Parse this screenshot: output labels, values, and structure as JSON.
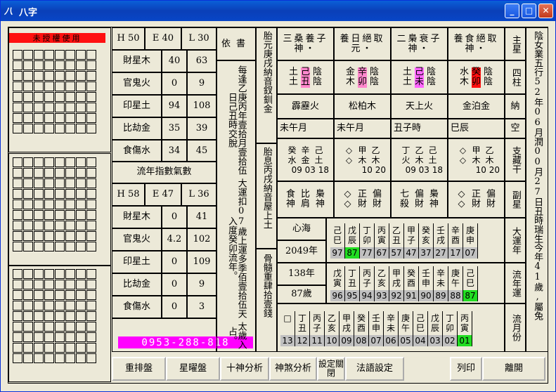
{
  "window": {
    "title": "八字",
    "icon": "八"
  },
  "left": {
    "notice": "未授權使用",
    "grid_cells": 49
  },
  "index1": {
    "H": "H 50",
    "E": "E 40",
    "L": "L 30",
    "rows": [
      {
        "label": "財星木",
        "a": "40",
        "b": "63"
      },
      {
        "label": "官鬼火",
        "a": "0",
        "b": "9"
      },
      {
        "label": "印星土",
        "a": "94",
        "b": "108"
      },
      {
        "label": "比劫金",
        "a": "35",
        "b": "39"
      },
      {
        "label": "食傷水",
        "a": "34",
        "b": "45"
      }
    ]
  },
  "flow_title": "流年指數氣數",
  "index2": {
    "H": "H 58",
    "E": "E 47",
    "L": "L 36",
    "rows": [
      {
        "label": "財星木",
        "a": "0",
        "b": "41"
      },
      {
        "label": "官鬼火",
        "a": "4.2",
        "b": "102"
      },
      {
        "label": "印星土",
        "a": "0",
        "b": "109"
      },
      {
        "label": "比劫金",
        "a": "0",
        "b": "9"
      },
      {
        "label": "食傷水",
        "a": "0",
        "b": "3"
      }
    ]
  },
  "phone": "0953-288-818",
  "yishu": {
    "header": "依書",
    "col1": "每逢乙庚丙年壹拾月壹拾伍日己丑時交脫",
    "col2": "大運扣07歲上運多季佰壹拾伍天入度癸卯流年。",
    "col3": "太歲入占。"
  },
  "taiyuan": {
    "col1": "胎元庚戌納音釵釧金",
    "col2": "胎息丙戌納音屋上土",
    "col3": "骨髓重肆拾壹錢"
  },
  "pillars": [
    {
      "shen": "三桑養子神・",
      "stem": "土",
      "branch": "土",
      "gz": "己丑",
      "yy": "陰陰",
      "nayin": "霹靂火",
      "date": "未午月",
      "h1": "癸水",
      "h2": "辛金",
      "h3": "己土",
      "n": "09 03 18",
      "g1": "食神",
      "g2": "比肩",
      "g3": "梟神",
      "color": "#ff88cc"
    },
    {
      "shen": "養日絕取元・",
      "stem": "金",
      "branch": "木",
      "gz": "辛卯",
      "yy": "陰陰",
      "nayin": "松柏木",
      "date": "未午月",
      "h1": "◇◇",
      "h2": "甲木",
      "h3": "乙木",
      "n": "10 20",
      "g1": "◇◇",
      "g2": "正財",
      "g3": "偏財",
      "color": "#ff88cc"
    },
    {
      "shen": "二梟衰子神・",
      "stem": "土",
      "branch": "土",
      "gz": "己未",
      "yy": "陰陰",
      "nayin": "天上火",
      "date": "丑子時",
      "h1": "丁火",
      "h2": "乙木",
      "h3": "己土",
      "n": "09 03 18",
      "g1": "七殺",
      "g2": "偏財",
      "g3": "梟神",
      "color": "#ff66ff"
    },
    {
      "shen": "養食絕取神・",
      "stem": "水",
      "branch": "木",
      "gz": "癸卯",
      "yy": "陰陰",
      "nayin": "金泊金",
      "date": "巳辰",
      "h1": "◇◇",
      "h2": "甲木",
      "h3": "乙木",
      "n": "10 20",
      "g1": "◇◇",
      "g2": "正財",
      "g3": "偏財",
      "color": "#ff1010"
    }
  ],
  "right_labels": {
    "zhu": "主星",
    "sizhu": "四柱",
    "na": "納",
    "kong": "空",
    "zhicang": "支藏干",
    "fuxing": "副星",
    "dayun": "大運年",
    "liunian": "流年運",
    "liuyue": "流月份"
  },
  "far_right": "陰女業五行52年06月潤00月27日丑時瑞生今年41歲,屬兔",
  "dayun": {
    "label1": "心海",
    "year": "2049年",
    "gz": [
      "己巳",
      "戊辰",
      "丁卯",
      "丙寅",
      "乙丑",
      "甲子",
      "癸亥",
      "壬戌",
      "辛酉",
      "庚申"
    ],
    "nums": [
      "97",
      "87",
      "77",
      "67",
      "57",
      "47",
      "37",
      "27",
      "17",
      "07"
    ],
    "hl": 1
  },
  "liunian": {
    "label1": "138年",
    "label2": "87歲",
    "gz": [
      "戊寅",
      "丁丑",
      "丙子",
      "乙亥",
      "甲戌",
      "癸酉",
      "壬申",
      "辛未",
      "庚午",
      "己巳"
    ],
    "nums": [
      "96",
      "95",
      "94",
      "93",
      "92",
      "91",
      "90",
      "89",
      "88",
      "87"
    ],
    "hl": 9
  },
  "liuyue": {
    "gz": [
      "丁丑",
      "丙子",
      "乙亥",
      "甲戌",
      "癸酉",
      "壬申",
      "辛未",
      "庚午",
      "己巳",
      "戊辰",
      "丁卯",
      "丙寅"
    ],
    "nums": [
      "13",
      "12",
      "11",
      "10",
      "09",
      "08",
      "07",
      "06",
      "05",
      "04",
      "03",
      "02",
      "01"
    ],
    "hl": 12
  },
  "bottom_label": "骨髓重肆拾壹錢",
  "buttons": {
    "rearrange": "重排盤",
    "star": "星曜盤",
    "tengod": "十神分析",
    "shensha": "神煞分析",
    "setting": "設定關閉",
    "method": "法語設定",
    "print": "列印",
    "leave": "離開"
  }
}
